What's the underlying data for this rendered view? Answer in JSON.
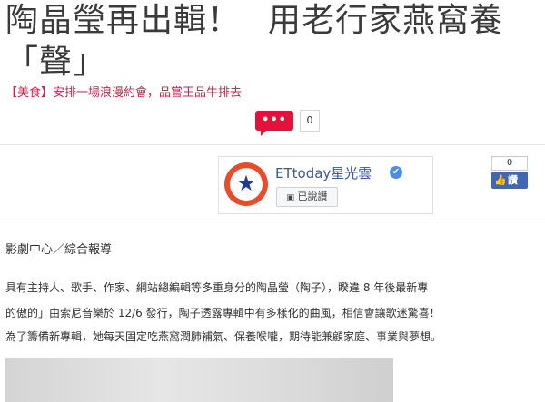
{
  "article": {
    "title_line1a": "陶晶瑩再出輯！",
    "title_line1b": "用老行家燕窩養",
    "title_line2": "「聲」",
    "promo_link": "【美食】安排一場浪漫約會，品嘗王品牛排去",
    "byline": "影劇中心／綜合報導",
    "paragraphs": [
      "具有主持人、歌手、作家、網站總編輯等多重身分的陶晶瑩（陶子），睽違 8 年後最新專",
      "的傲的」由索尼音樂於 12/6 發行，陶子透露專輯中有多樣化的曲風，相信會讓歌迷驚喜！",
      "為了籌備新專輯，她每天固定吃燕窩潤肺補氣、保養喉嚨，期待能兼顧家庭、事業與夢想。"
    ]
  },
  "comments": {
    "button_label": "•••",
    "count": "0"
  },
  "fanpage": {
    "name": "ETtoday星光雲",
    "verified_icon": "✔",
    "follow_label": "已說讚",
    "follow_icon": "fb-like-icon",
    "logo_icon": "star-icon"
  },
  "facebook_like": {
    "count": "0",
    "label": "讚",
    "thumb": "👍"
  }
}
